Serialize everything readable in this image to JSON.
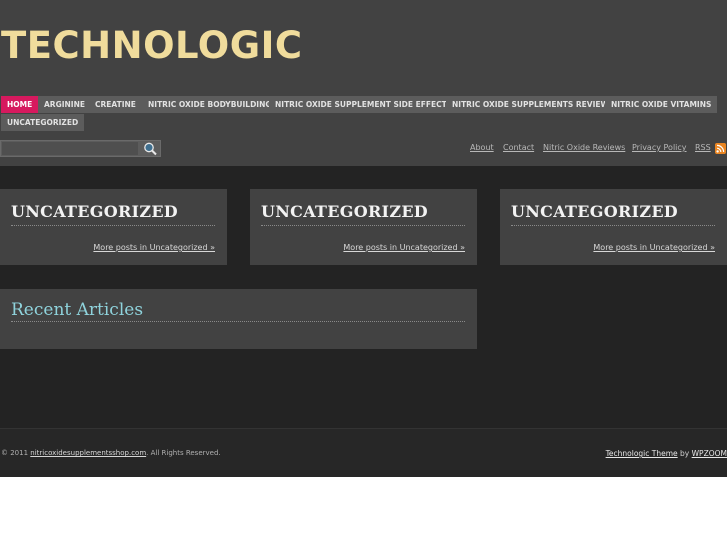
{
  "site": {
    "title": "TECHNOLOGIC"
  },
  "nav": {
    "items": [
      {
        "label": "HOME",
        "active": true
      },
      {
        "label": "ARGININE"
      },
      {
        "label": "CREATINE"
      },
      {
        "label": "NITRIC OXIDE BODYBUILDING"
      },
      {
        "label": "NITRIC OXIDE SUPPLEMENT SIDE EFFECTS"
      },
      {
        "label": "NITRIC OXIDE SUPPLEMENTS REVIEW"
      },
      {
        "label": "NITRIC OXIDE VITAMINS"
      },
      {
        "label": "UNCATEGORIZED"
      }
    ]
  },
  "search": {
    "value": "",
    "placeholder": ""
  },
  "top_links": [
    "About",
    "Contact",
    "Nitric Oxide Reviews",
    "Privacy Policy",
    "RSS"
  ],
  "category_boxes": [
    {
      "title": "UNCATEGORIZED",
      "more": "More posts in Uncategorized »"
    },
    {
      "title": "UNCATEGORIZED",
      "more": "More posts in Uncategorized »"
    },
    {
      "title": "UNCATEGORIZED",
      "more": "More posts in Uncategorized »"
    }
  ],
  "recent": {
    "title": "Recent Articles"
  },
  "footer": {
    "copyright_prefix": "© 2011",
    "domain": "nitricoxidesupplementsshop.com",
    "rights": ". All Rights Reserved.",
    "theme": "Technologic Theme",
    "by": "by",
    "author": "WPZOOM"
  },
  "colors": {
    "accent": "#d6195e",
    "logo": "#f0dc9c",
    "recent_title": "#8fd3dc",
    "rss": "#e98522"
  },
  "icons": {
    "search": "magnifier-icon",
    "rss": "rss-icon"
  }
}
